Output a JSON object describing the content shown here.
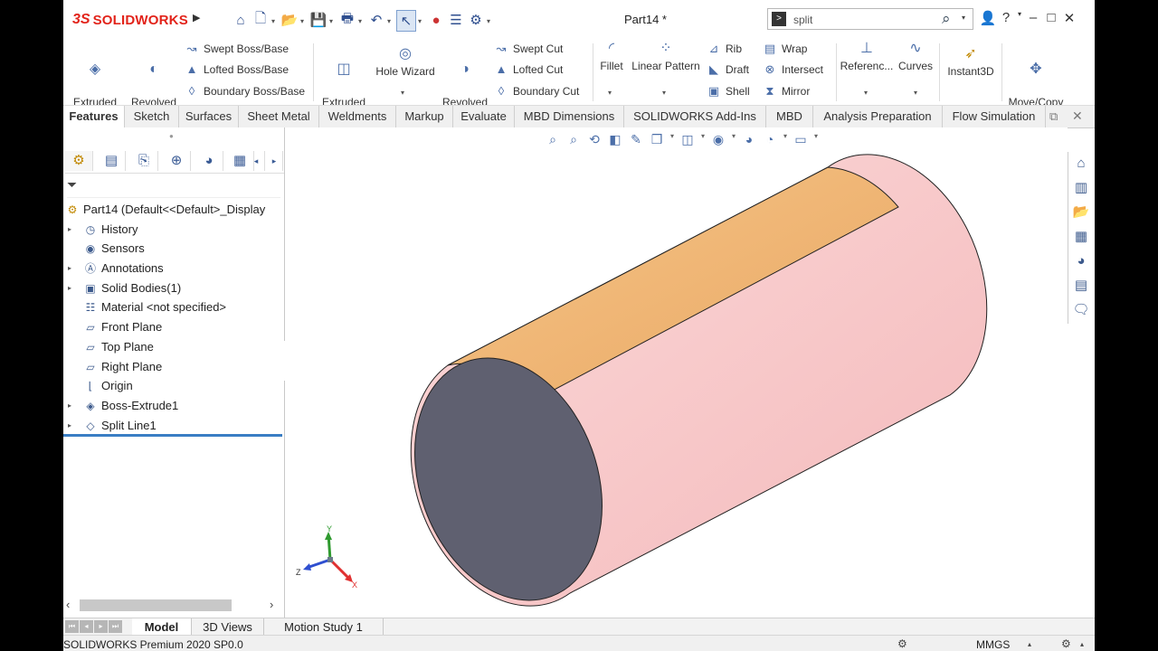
{
  "app": {
    "brand_ds": "3S",
    "brand_name": "SOLIDWORKS",
    "document_title": "Part14 *",
    "accent_color": "#e2231a"
  },
  "search": {
    "value": "split"
  },
  "quick_access": [
    "home-icon",
    "new-document-icon",
    "open-folder-icon",
    "save-icon",
    "print-icon",
    "undo-icon",
    "select-cursor-icon",
    "rebuild-traffic-light-icon",
    "file-properties-icon",
    "options-gear-icon"
  ],
  "ribbon": {
    "extruded_boss": "Extruded\nBoss/Base",
    "revolved_boss": "Revolved\nBoss/Base",
    "swept_boss": "Swept Boss/Base",
    "lofted_boss": "Lofted Boss/Base",
    "boundary_boss": "Boundary Boss/Base",
    "extruded_cut": "Extruded\nCut",
    "hole_wizard": "Hole Wizard",
    "revolved_cut": "Revolved\nCut",
    "swept_cut": "Swept Cut",
    "lofted_cut": "Lofted Cut",
    "boundary_cut": "Boundary Cut",
    "fillet": "Fillet",
    "linear_pattern": "Linear Pattern",
    "rib": "Rib",
    "draft": "Draft",
    "shell": "Shell",
    "wrap": "Wrap",
    "intersect": "Intersect",
    "mirror": "Mirror",
    "reference": "Referenc...",
    "curves": "Curves",
    "instant3d": "Instant3D",
    "move_copy": "Move/Copy\nBodies"
  },
  "command_tabs": [
    "Features",
    "Sketch",
    "Surfaces",
    "Sheet Metal",
    "Weldments",
    "Markup",
    "Evaluate",
    "MBD Dimensions",
    "SOLIDWORKS Add-Ins",
    "MBD",
    "Analysis Preparation",
    "Flow Simulation"
  ],
  "active_command_tab": "Features",
  "feature_tree": {
    "root": "Part14  (Default<<Default>_Display",
    "items": [
      {
        "label": "History",
        "icon": "history-folder-icon",
        "expandable": true
      },
      {
        "label": "Sensors",
        "icon": "sensors-folder-icon",
        "expandable": false
      },
      {
        "label": "Annotations",
        "icon": "annotations-folder-icon",
        "expandable": true
      },
      {
        "label": "Solid Bodies(1)",
        "icon": "solid-bodies-folder-icon",
        "expandable": true
      },
      {
        "label": "Material <not specified>",
        "icon": "material-icon",
        "expandable": false
      },
      {
        "label": "Front Plane",
        "icon": "plane-icon",
        "expandable": false
      },
      {
        "label": "Top Plane",
        "icon": "plane-icon",
        "expandable": false
      },
      {
        "label": "Right Plane",
        "icon": "plane-icon",
        "expandable": false
      },
      {
        "label": "Origin",
        "icon": "origin-icon",
        "expandable": false
      },
      {
        "label": "Boss-Extrude1",
        "icon": "boss-extrude-icon",
        "expandable": true
      },
      {
        "label": "Split Line1",
        "icon": "split-line-icon",
        "expandable": true
      }
    ]
  },
  "triad": {
    "x": "X",
    "y": "Y",
    "z": "Z"
  },
  "model_colors": {
    "face_top": "#f2b777",
    "face_side": "#f9cccc",
    "end_cap": "#5f6070",
    "triad_x": "#e03030",
    "triad_y": "#2f9a2f",
    "triad_z": "#2f4fd0"
  },
  "bottom_tabs": [
    "Model",
    "3D Views",
    "Motion Study 1"
  ],
  "active_bottom_tab": "Model",
  "status": {
    "product": "SOLIDWORKS Premium 2020 SP0.0",
    "units": "MMGS"
  }
}
